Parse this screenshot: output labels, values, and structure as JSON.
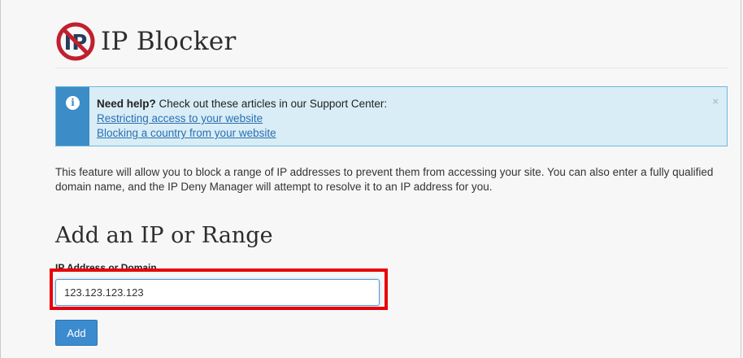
{
  "header": {
    "title": "IP Blocker",
    "logo_letters": "IP",
    "logo_icon": "ip-blocked-icon"
  },
  "alert": {
    "icon": "info-icon",
    "icon_glyph": "i",
    "lead": "Need help?",
    "text": " Check out these articles in our Support Center:",
    "links": [
      "Restricting access to your website",
      "Blocking a country from your website"
    ],
    "close_glyph": "×"
  },
  "description": "This feature will allow you to block a range of IP addresses to prevent them from accessing your site. You can also enter a fully qualified domain name, and the IP Deny Manager will attempt to resolve it to an IP address for you.",
  "form": {
    "heading": "Add an IP or Range",
    "label": "IP Address or Domain",
    "value": "123.123.123.123",
    "add_label": "Add"
  },
  "colors": {
    "accent": "#3c8bcf",
    "alert_bg": "#d9edf7",
    "highlight": "#e8000a",
    "logo_red": "#c0202e"
  }
}
